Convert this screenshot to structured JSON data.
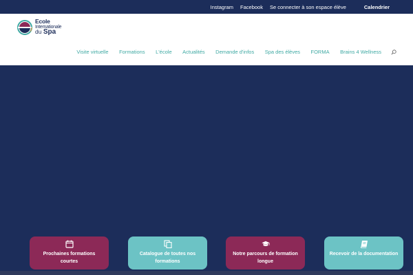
{
  "topbar": {
    "links": [
      "Instagram",
      "Facebook",
      "Se connecter à son espace élève"
    ],
    "calendar": "Calendrier"
  },
  "logo": {
    "line1": "Ecole",
    "line2": "Internationale",
    "line3_small": "du",
    "line3_big": "Spa"
  },
  "nav": {
    "items": [
      "Visite virtuelle",
      "Formations",
      "L'école",
      "Actualités",
      "Demande d'infos",
      "Spa des élèves",
      "FORMA",
      "Brains 4 Wellness"
    ],
    "search_icon": "search-icon"
  },
  "cards": [
    {
      "label": "Prochaines formations courtes",
      "icon": "calendar-icon",
      "color": "#8c2957"
    },
    {
      "label": "Catalogue de toutes nos formations",
      "icon": "copy-icon",
      "color": "#6cc3c5"
    },
    {
      "label": "Notre parcours de formation longue",
      "icon": "graduation-cap-icon",
      "color": "#8c2957"
    },
    {
      "label": "Recevoir de la documentation",
      "icon": "book-icon",
      "color": "#6cc3c5"
    }
  ],
  "colors": {
    "navy": "#1c2d5a",
    "teal": "#3fa9a3",
    "purple": "#8c2957",
    "light_teal": "#6cc3c5"
  }
}
